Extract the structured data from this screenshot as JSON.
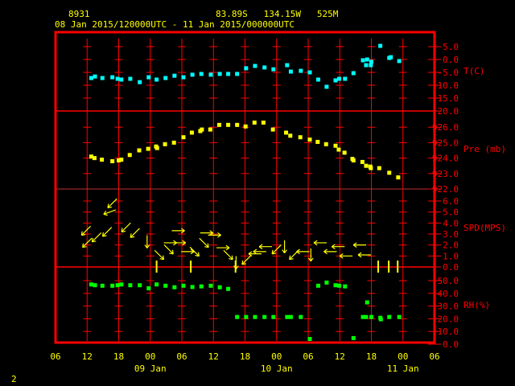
{
  "header": {
    "station": "8931",
    "location": "83.89S   134.15W   525M",
    "period": "08 Jan 2015/120000UTC - 11 Jan 2015/000000UTC"
  },
  "footer": {
    "page_number": "2"
  },
  "colors": {
    "frame": "#ff0000",
    "text": "#ffff00",
    "temperature": "#00ffff",
    "pressure": "#ffff00",
    "wind": "#ffff00",
    "rh": "#00ff00",
    "background": "#000000"
  },
  "chart_data": {
    "type": "scatter",
    "title": "8931 meteogram 08 Jan 2015/120000UTC - 11 Jan 2015/000000UTC",
    "x_unit": "hours since 08 Jan 2015 06 UTC",
    "xlim": [
      0,
      72
    ],
    "x_ticks": [
      "06",
      "12",
      "18",
      "00",
      "06",
      "12",
      "18",
      "00",
      "06",
      "12",
      "18",
      "00",
      "06"
    ],
    "date_labels": [
      {
        "label": "09 Jan",
        "hour": 18
      },
      {
        "label": "10 Jan",
        "hour": 42
      },
      {
        "label": "11 Jan",
        "hour": 66
      }
    ],
    "panels": [
      {
        "name": "temperature",
        "ylabel": "T(C)",
        "ylim": [
          -20,
          5
        ],
        "ticks": [
          "5.0",
          "0.0",
          "-5.0",
          "-10.0",
          "-15.0",
          "-20.0"
        ],
        "tick_values": [
          5,
          0,
          -5,
          -10,
          -15,
          -20
        ],
        "x": [
          6.8,
          7.5,
          8.9,
          10.8,
          11.8,
          12.5,
          14.2,
          16,
          17.7,
          19.2,
          20.9,
          22.6,
          24.3,
          26,
          27.7,
          29.5,
          31.2,
          32.8,
          34.5,
          36.2,
          37.9,
          39.7,
          41.4,
          44,
          44.7,
          46.6,
          48.3,
          49.9,
          51.5,
          53.2,
          53.9,
          55,
          56.6,
          58.4,
          59.2,
          59,
          60,
          59.9,
          61.7,
          63.4,
          63.7,
          65.3
        ],
        "y": [
          -7.2,
          -6.6,
          -7.2,
          -6.9,
          -7.5,
          -7.8,
          -7.5,
          -8.8,
          -6.9,
          -7.8,
          -7.2,
          -6.3,
          -6.9,
          -5.9,
          -5.6,
          -5.9,
          -5.6,
          -5.6,
          -5.6,
          -3.4,
          -2.5,
          -3.1,
          -3.8,
          -2.2,
          -4.7,
          -4.4,
          -5.0,
          -7.8,
          -10.6,
          -8.1,
          -7.5,
          -7.5,
          -5.3,
          -0.3,
          0.0,
          -2.2,
          -0.9,
          -2.2,
          5.3,
          0.6,
          0.9,
          -0.6
        ]
      },
      {
        "name": "pressure",
        "ylabel": "Pre (mb)",
        "ylim": [
          922,
          927
        ],
        "ticks": [
          "926.0",
          "925.0",
          "924.0",
          "923.0",
          "922.0"
        ],
        "tick_values": [
          926,
          925,
          924,
          923,
          922
        ],
        "x": [
          6.8,
          7.4,
          8.8,
          10.8,
          12,
          12.5,
          14.1,
          15.9,
          17.6,
          19.1,
          19.3,
          20.8,
          22.5,
          24.3,
          25.9,
          27.5,
          27.8,
          29.4,
          31.1,
          32.8,
          34.5,
          36.1,
          37.8,
          39.5,
          41.3,
          43.8,
          44.6,
          46.5,
          48.3,
          49.8,
          51.4,
          53.2,
          53.8,
          54.9,
          56.4,
          56.6,
          58.3,
          59,
          59.8,
          59.9,
          61.5,
          63.4,
          65.1
        ],
        "y": [
          924.1,
          924.0,
          923.9,
          923.8,
          923.85,
          923.9,
          924.2,
          924.5,
          924.6,
          924.75,
          924.65,
          924.9,
          925.0,
          925.35,
          925.65,
          925.75,
          925.85,
          925.85,
          926.15,
          926.15,
          926.15,
          926.05,
          926.3,
          926.3,
          925.85,
          925.65,
          925.45,
          925.35,
          925.2,
          925.05,
          924.9,
          924.8,
          924.55,
          924.35,
          923.95,
          923.85,
          923.75,
          923.5,
          923.45,
          923.35,
          923.35,
          923.05,
          922.75
        ]
      },
      {
        "name": "wind",
        "ylabel": "SPD(MPS)",
        "ylim": [
          0,
          6
        ],
        "ticks": [
          "6.0",
          "5.0",
          "4.0",
          "3.0",
          "2.0",
          "1.0",
          "0.0"
        ],
        "tick_values": [
          6,
          5,
          4,
          3,
          2,
          1,
          0
        ],
        "x": [
          5.8,
          6,
          7.8,
          9.8,
          10.8,
          10.3,
          13.4,
          15.1,
          17.4,
          19.7,
          21.5,
          21.8,
          23.5,
          23.3,
          25.1,
          26.4,
          28.2,
          28.7,
          30.2,
          31.8,
          32.8,
          34.3,
          36.3,
          37.9,
          39.9,
          38.8,
          42.0,
          43.5,
          45.3,
          47.0,
          48.5,
          50.3,
          52.2,
          53.7,
          55.2,
          57.8,
          58.7
        ],
        "speed": [
          3.3,
          2.2,
          2.7,
          3.2,
          5.8,
          5.0,
          3.6,
          3.1,
          2.3,
          1.1,
          1.6,
          2.2,
          2.2,
          3.3,
          1.4,
          1.4,
          2.2,
          3.1,
          2.9,
          1.75,
          1.1,
          0.4,
          0.65,
          1.2,
          1.85,
          1.4,
          1.6,
          1.85,
          1.1,
          1.4,
          1.1,
          2.2,
          1.4,
          1.85,
          1.0,
          2.0,
          1.1
        ],
        "toward_deg": [
          225,
          225,
          225,
          225,
          225,
          250,
          225,
          225,
          180,
          135,
          135,
          90,
          90,
          90,
          90,
          135,
          135,
          90,
          90,
          90,
          135,
          180,
          225,
          270,
          270,
          270,
          225,
          180,
          225,
          270,
          180,
          270,
          270,
          270,
          270,
          270,
          270
        ],
        "calm_x": [
          19.2,
          25.7,
          34.2,
          61.3,
          63.3,
          65
        ]
      },
      {
        "name": "rh",
        "ylabel": "RH(%)",
        "ylim": [
          0,
          50
        ],
        "ticks": [
          "50.0",
          "40.0",
          "30.0",
          "20.0",
          "10.0",
          "0.0"
        ],
        "tick_values": [
          50,
          40,
          30,
          20,
          10,
          0
        ],
        "x": [
          6.8,
          7.5,
          8.9,
          10.8,
          11.8,
          12.5,
          14.2,
          16,
          17.7,
          19.2,
          20.9,
          22.6,
          24.3,
          26,
          27.7,
          29.5,
          31.2,
          32.8,
          34.5,
          36.2,
          37.9,
          39.7,
          41.4,
          44,
          44.7,
          46.6,
          48.3,
          49.9,
          51.5,
          53.2,
          53.9,
          55,
          56.6,
          58.4,
          59.2,
          59,
          60,
          61.7,
          61.8,
          63.4,
          65.3
        ],
        "y": [
          47,
          46.4,
          46,
          46,
          46.4,
          47,
          46.4,
          46.4,
          44,
          47,
          46,
          44.8,
          46,
          45,
          45.5,
          46,
          44.8,
          43.5,
          21.4,
          21.4,
          21.4,
          21.4,
          21.4,
          21.4,
          21.4,
          21.4,
          4.1,
          46,
          48.5,
          46.4,
          46,
          45.5,
          4.8,
          21.4,
          32.9,
          21.4,
          21.4,
          20.8,
          19.6,
          21.4,
          21.4
        ]
      }
    ]
  }
}
